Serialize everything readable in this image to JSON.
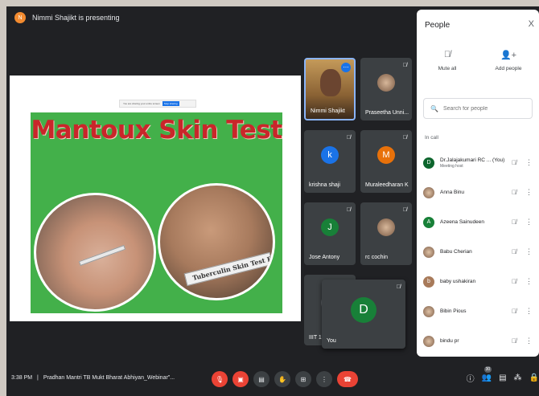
{
  "presenting": {
    "avatar_initial": "N",
    "text": "Nimmi Shajikt is presenting"
  },
  "shared_screen": {
    "toolbar_text": "You are sharing your entire screen",
    "stop_label": "Stop sharing",
    "slide_title": "Mantoux Skin Test",
    "ruler_text": "Tuberculin Skin Test Ru"
  },
  "tiles": [
    {
      "name": "Nimmi Shajikt",
      "type": "video"
    },
    {
      "name": "Praseetha Unni...",
      "type": "photo"
    },
    {
      "name": "krishna shaji",
      "initial": "k",
      "color": "#1a73e8"
    },
    {
      "name": "Muraleedharan K",
      "initial": "M",
      "color": "#e8710a"
    },
    {
      "name": "Jose Antony",
      "initial": "J",
      "color": "#188038"
    },
    {
      "name": "rc cochin",
      "type": "photo"
    },
    {
      "name": "IIIT 14",
      "initial": "I",
      "color": "#5f6368"
    }
  ],
  "self_tile": {
    "name": "You",
    "initial": "D"
  },
  "people_panel": {
    "title": "People",
    "close_glyph": "X",
    "mute_all_label": "Mute all",
    "add_people_label": "Add people",
    "search_placeholder": "Search for people",
    "in_call_label": "In call",
    "participants": [
      {
        "name": "Dr.Jalajakumari RC ... (You)",
        "subtitle": "Meeting host",
        "initial": "D",
        "color": "#0d652d",
        "photo": false
      },
      {
        "name": "Anna Binu",
        "subtitle": "",
        "initial": "",
        "color": "",
        "photo": true
      },
      {
        "name": "Azeena Sainudeen",
        "subtitle": "",
        "initial": "A",
        "color": "#188038",
        "photo": false
      },
      {
        "name": "Babu Cherian",
        "subtitle": "",
        "initial": "",
        "color": "",
        "photo": true
      },
      {
        "name": "baby ushakiran",
        "subtitle": "",
        "initial": "b",
        "color": "#a87a5a",
        "photo": false
      },
      {
        "name": "Bibin Pious",
        "subtitle": "",
        "initial": "",
        "color": "",
        "photo": true
      },
      {
        "name": "bindu pr",
        "subtitle": "",
        "initial": "",
        "color": "",
        "photo": true
      }
    ]
  },
  "bottom_bar": {
    "time": "3:38 PM",
    "separator": "|",
    "meeting_name": "Pradhan Mantri TB Mukt Bharat Abhiyan_Webinar\"...",
    "participant_count": "30"
  }
}
